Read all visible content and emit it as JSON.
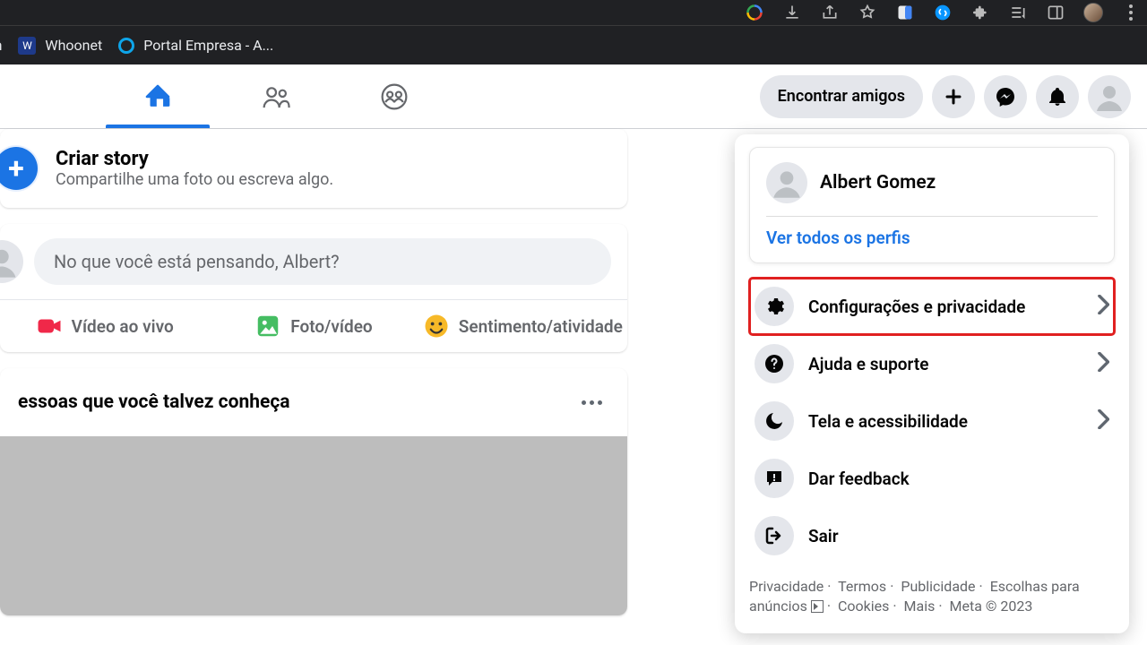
{
  "browser": {
    "bookmarks": [
      {
        "label": "tch"
      },
      {
        "label": "Whoonet"
      },
      {
        "label": "Portal Empresa - A..."
      }
    ]
  },
  "topnav": {
    "find_friends": "Encontrar amigos"
  },
  "story": {
    "title": "Criar story",
    "subtitle": "Compartilhe uma foto ou escreva algo."
  },
  "composer": {
    "placeholder": "No que você está pensando, Albert?",
    "live": "Vídeo ao vivo",
    "photo": "Foto/vídeo",
    "feeling": "Sentimento/atividade"
  },
  "pymk": {
    "title": "essoas que você talvez conheça"
  },
  "panel": {
    "user_name": "Albert Gomez",
    "all_profiles": "Ver todos os perfis",
    "items": {
      "settings": "Configurações e privacidade",
      "help": "Ajuda e suporte",
      "display": "Tela e acessibilidade",
      "feedback": "Dar feedback",
      "logout": "Sair"
    },
    "footer": {
      "privacy": "Privacidade",
      "terms": "Termos",
      "ads": "Publicidade",
      "ad_choices": "Escolhas para anúncios",
      "cookies": "Cookies",
      "more": "Mais",
      "meta": "Meta © 2023"
    }
  }
}
